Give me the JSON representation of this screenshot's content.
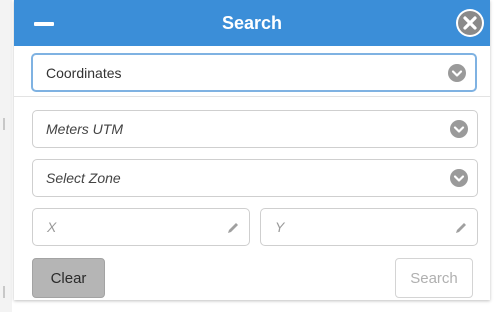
{
  "header": {
    "title": "Search"
  },
  "search_type": {
    "selected": "Coordinates"
  },
  "units": {
    "selected": "Meters UTM"
  },
  "zone": {
    "selected": "Select Zone"
  },
  "coordinates": {
    "x_placeholder": "X",
    "y_placeholder": "Y"
  },
  "actions": {
    "clear_label": "Clear",
    "search_label": "Search",
    "search_enabled": false
  },
  "colors": {
    "header_bg": "#3b8ed8",
    "focus_border": "#7fb2e2",
    "clear_bg": "#b5b5b5"
  },
  "icons": {
    "minimize": "minimize-icon",
    "close": "close-icon",
    "dropdown": "chevron-down-icon",
    "edit": "pencil-icon"
  }
}
